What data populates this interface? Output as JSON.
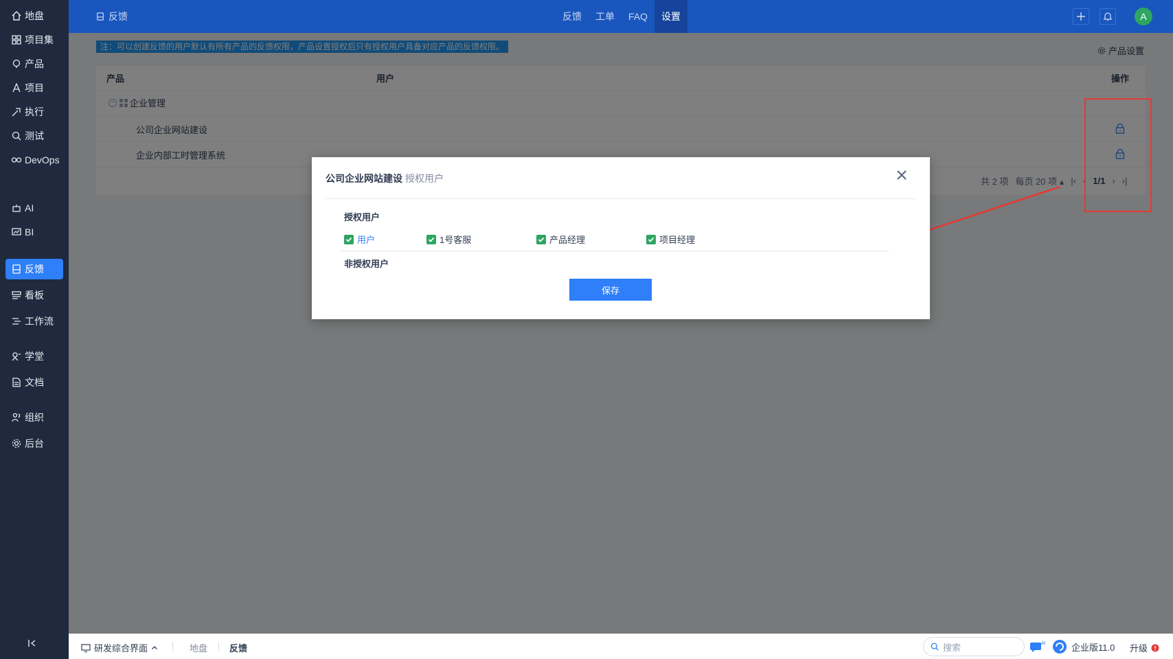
{
  "sidebar": {
    "items": [
      {
        "label": "地盘",
        "icon": "home-icon"
      },
      {
        "label": "项目集",
        "icon": "grid-icon"
      },
      {
        "label": "产品",
        "icon": "bulb-icon"
      },
      {
        "label": "项目",
        "icon": "project-icon"
      },
      {
        "label": "执行",
        "icon": "execute-icon"
      },
      {
        "label": "测试",
        "icon": "test-icon"
      },
      {
        "label": "DevOps",
        "icon": "devops-icon"
      },
      {
        "label": "AI",
        "icon": "robot-icon"
      },
      {
        "label": "BI",
        "icon": "chart-icon"
      },
      {
        "label": "反馈",
        "icon": "feedback-icon"
      },
      {
        "label": "看板",
        "icon": "board-icon"
      },
      {
        "label": "工作流",
        "icon": "workflow-icon"
      },
      {
        "label": "学堂",
        "icon": "school-icon"
      },
      {
        "label": "文档",
        "icon": "doc-icon"
      },
      {
        "label": "组织",
        "icon": "org-icon"
      },
      {
        "label": "后台",
        "icon": "gear-icon"
      }
    ],
    "active": "反馈"
  },
  "header": {
    "title": "反馈",
    "nav": [
      "反馈",
      "工单",
      "FAQ",
      "设置"
    ],
    "active_nav": "设置",
    "avatar": "A"
  },
  "main": {
    "notice": "注：可以创建反馈的用户默认有所有产品的反馈权限，产品设置授权后只有授权用户具备对应产品的反馈权限。",
    "product_setting": "产品设置",
    "table": {
      "headers": {
        "product": "产品",
        "users": "用户",
        "actions": "操作"
      },
      "group": "企业管理",
      "rows": [
        "公司企业网站建设",
        "企业内部工时管理系统"
      ]
    },
    "pager": {
      "total": "共 2 项",
      "per_page": "每页 20 项",
      "page": "1/1"
    }
  },
  "modal": {
    "title": "公司企业网站建设",
    "subtitle": "授权用户",
    "authorized_label": "授权用户",
    "unauthorized_label": "非授权用户",
    "checkboxes": [
      "用户",
      "1号客服",
      "产品经理",
      "项目经理"
    ],
    "save": "保存"
  },
  "footer": {
    "workspace": "研发综合界面",
    "crumbs": [
      "地盘",
      "反馈"
    ],
    "search_placeholder": "搜索",
    "edition": "企业版11.0",
    "upgrade": "升级"
  },
  "colors": {
    "accent": "#2e7ff8",
    "header": "#1956be",
    "sidebar": "#1f2a3e",
    "check": "#2ea562",
    "annotation": "#e53935"
  }
}
